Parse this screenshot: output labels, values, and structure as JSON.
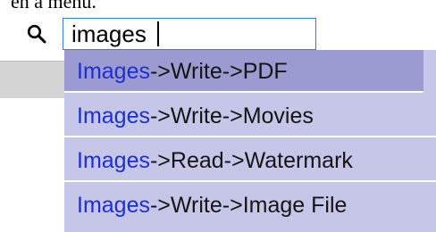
{
  "caption": "en a menu.",
  "search": {
    "value": "images",
    "icon": "search-icon"
  },
  "menu": {
    "items": [
      {
        "match": "Images",
        "rest": "->Write->PDF",
        "selected": true
      },
      {
        "match": "Images",
        "rest": "->Write->Movies",
        "selected": false
      },
      {
        "match": "Images",
        "rest": "->Read->Watermark",
        "selected": false
      },
      {
        "match": "Images",
        "rest": "->Write->Image File",
        "selected": false
      }
    ]
  },
  "colors": {
    "match_text": "#1c2fd4",
    "menu_background": "#c6c6e9",
    "selected_background": "#9b9bd1",
    "input_border": "#3c7fd0"
  }
}
